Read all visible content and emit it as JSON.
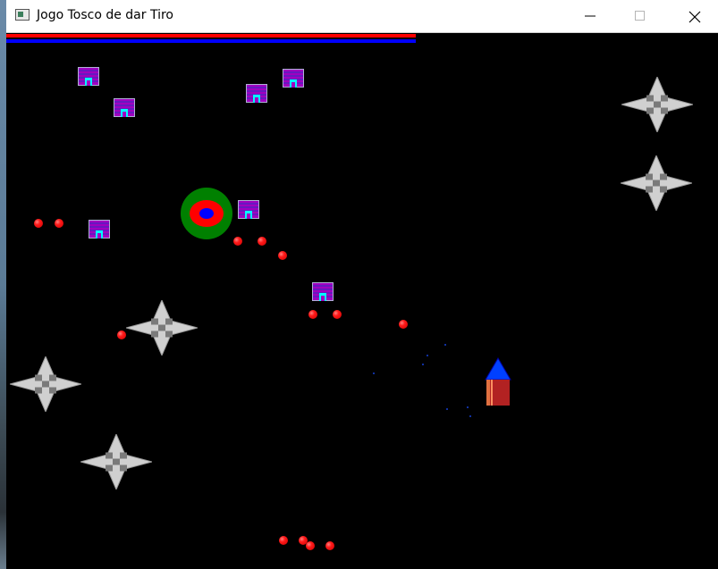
{
  "window": {
    "title": "Jogo Tosco de dar Tiro"
  },
  "hud": {
    "health_fraction": 0.575,
    "shield_fraction": 0.575,
    "health_color": "#ff0000",
    "shield_color": "#0000ff"
  },
  "colors": {
    "background": "#000000",
    "enemy_body": "#a000c0",
    "enemy_window": "#00ffff",
    "star_light": "#d0d0d0",
    "star_dark": "#7a7a7a",
    "target_outer": "#008000",
    "target_middle": "#ff0000",
    "target_inner": "#0000ff",
    "player_tip": "#0040ff",
    "player_body": "#b22222",
    "bullet": "#ff0000"
  },
  "icons": {
    "minimize": "minimize-icon",
    "maximize": "maximize-icon",
    "close": "close-icon",
    "app": "app-icon"
  },
  "entities": {
    "enemies": 7,
    "obstacles": 5,
    "bullets": 14,
    "targets": 1,
    "player": 1
  }
}
